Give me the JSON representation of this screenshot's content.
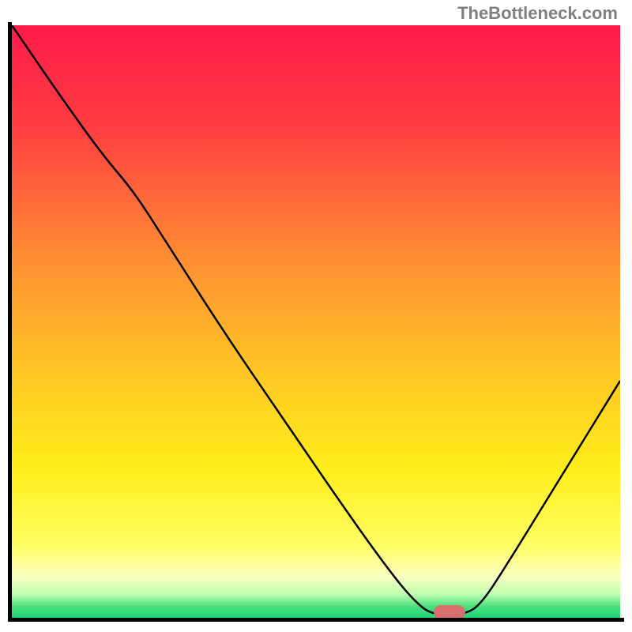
{
  "watermark": "TheBottleneck.com",
  "chart_data": {
    "type": "line",
    "title": "",
    "xlabel": "",
    "ylabel": "",
    "xlim": [
      0,
      100
    ],
    "ylim": [
      0,
      100
    ],
    "gradient_stops": [
      {
        "offset": 0,
        "color": "#ff1a4a"
      },
      {
        "offset": 18,
        "color": "#ff4040"
      },
      {
        "offset": 40,
        "color": "#ff9033"
      },
      {
        "offset": 58,
        "color": "#ffc525"
      },
      {
        "offset": 75,
        "color": "#ffee1a"
      },
      {
        "offset": 88,
        "color": "#ffff66"
      },
      {
        "offset": 93,
        "color": "#faffc0"
      },
      {
        "offset": 96,
        "color": "#c0ffb0"
      },
      {
        "offset": 98,
        "color": "#50e080"
      },
      {
        "offset": 100,
        "color": "#1dd675"
      }
    ],
    "curve_points": [
      {
        "x": 0,
        "y": 100
      },
      {
        "x": 8,
        "y": 88
      },
      {
        "x": 15,
        "y": 78
      },
      {
        "x": 20,
        "y": 72
      },
      {
        "x": 25,
        "y": 64
      },
      {
        "x": 35,
        "y": 48
      },
      {
        "x": 45,
        "y": 33
      },
      {
        "x": 55,
        "y": 18
      },
      {
        "x": 62,
        "y": 8
      },
      {
        "x": 66,
        "y": 3
      },
      {
        "x": 69,
        "y": 0.5
      },
      {
        "x": 74,
        "y": 0.5
      },
      {
        "x": 77,
        "y": 2
      },
      {
        "x": 82,
        "y": 10
      },
      {
        "x": 88,
        "y": 20
      },
      {
        "x": 94,
        "y": 30
      },
      {
        "x": 100,
        "y": 40
      }
    ],
    "marker": {
      "x": 72,
      "y": 1
    }
  }
}
